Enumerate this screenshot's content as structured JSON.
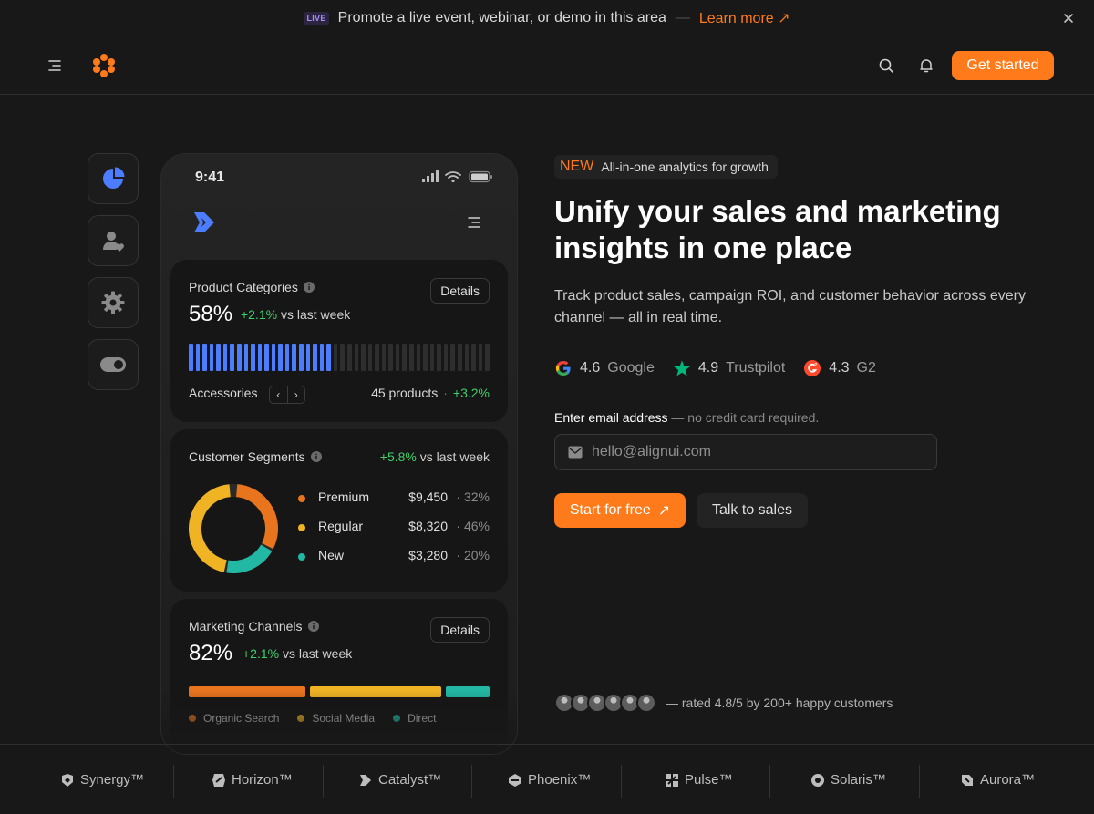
{
  "promo": {
    "badge": "LIVE",
    "text": "Promote a live event, webinar, or demo in this area",
    "separator": "—",
    "link": "Learn more ↗"
  },
  "nav": {
    "cta": "Get started"
  },
  "phone": {
    "time": "9:41",
    "product_categories": {
      "title": "Product Categories",
      "details": "Details",
      "value": "58%",
      "delta": "+2.1%",
      "delta_suffix": " vs last week",
      "filled_bars": 21,
      "total_bars": 44,
      "category": "Accessories",
      "pager_prev": "‹",
      "pager_next": "›",
      "products": "45 products",
      "dot": "·",
      "category_delta": "+3.2%"
    },
    "customer_segments": {
      "title": "Customer Segments",
      "delta": "+5.8%",
      "delta_suffix": " vs last week",
      "segments": [
        {
          "name": "Premium",
          "value": "$9,450",
          "pct": "· 32%",
          "share": 32,
          "color": "#e8741e"
        },
        {
          "name": "Regular",
          "value": "$8,320",
          "pct": "· 46%",
          "share": 46,
          "color": "#f0b323"
        },
        {
          "name": "New",
          "value": "$3,280",
          "pct": "· 20%",
          "share": 20,
          "color": "#22b8a4"
        }
      ]
    },
    "marketing_channels": {
      "title": "Marketing Channels",
      "details": "Details",
      "value": "82%",
      "delta": "+2.1%",
      "delta_suffix": " vs last week",
      "channels": [
        {
          "name": "Organic Search",
          "share": 40,
          "color": "#e8741e"
        },
        {
          "name": "Social Media",
          "share": 45,
          "color": "#f0b323"
        },
        {
          "name": "Direct",
          "share": 15,
          "color": "#22b8a4"
        }
      ]
    }
  },
  "hero": {
    "badge_new": "NEW",
    "badge_text": "All-in-one analytics for growth",
    "title": "Unify your sales and marketing insights in one place",
    "subtitle": "Track product sales, campaign ROI, and customer behavior across every channel — all in real time.",
    "ratings": [
      {
        "score": "4.6",
        "source": "Google"
      },
      {
        "score": "4.9",
        "source": "Trustpilot"
      },
      {
        "score": "4.3",
        "source": "G2"
      }
    ],
    "email_label": "Enter email address",
    "email_hint": " — no credit card required.",
    "email_placeholder": "hello@alignui.com",
    "start_button": "Start for free",
    "start_arrow": "↗",
    "talk_button": "Talk to sales",
    "social_text": "— rated 4.8/5 by 200+ happy customers"
  },
  "brands": [
    "Synergy™",
    "Horizon™",
    "Catalyst™",
    "Phoenix™",
    "Pulse™",
    "Solaris™",
    "Aurora™"
  ],
  "colors": {
    "accent": "#ff7a1a",
    "positive": "#3ecf6b",
    "bar_blue": "#4c7dff"
  }
}
